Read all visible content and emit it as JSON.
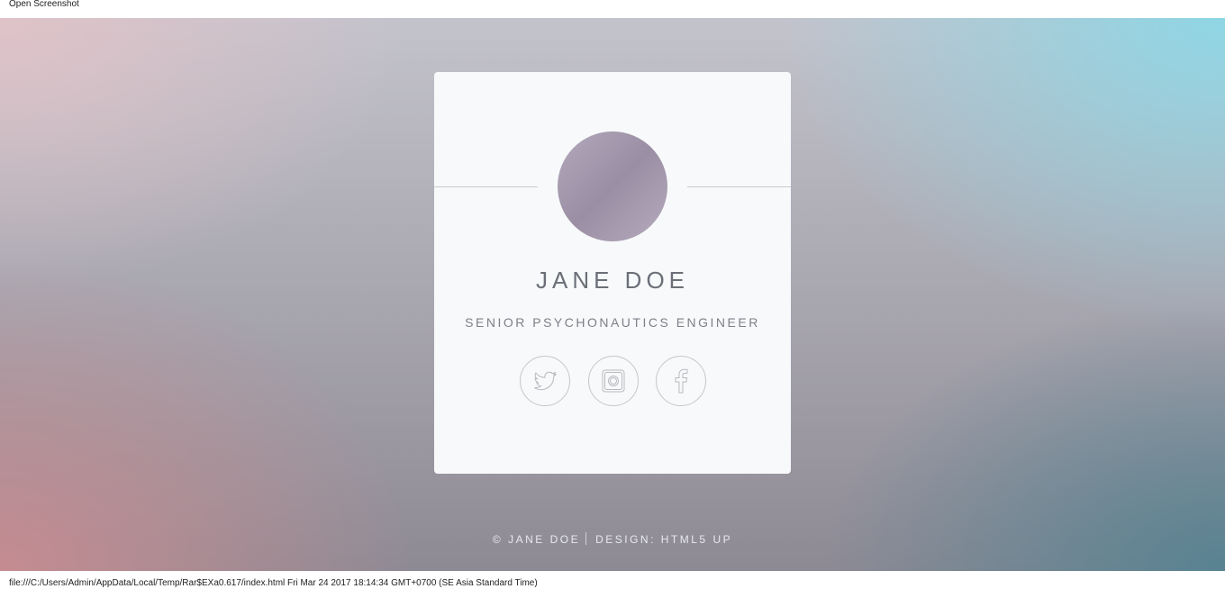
{
  "header": {
    "title": "Open Screenshot"
  },
  "profile": {
    "name": "JANE DOE",
    "role": "SENIOR PSYCHONAUTICS ENGINEER"
  },
  "socials": [
    {
      "label": "Twitter",
      "icon": "twitter-icon"
    },
    {
      "label": "Instagram",
      "icon": "instagram-icon"
    },
    {
      "label": "Facebook",
      "icon": "facebook-icon"
    }
  ],
  "footer": {
    "copyright": "© JANE DOE",
    "design_prefix": "DESIGN: ",
    "design_link": "HTML5 UP"
  },
  "status": {
    "text": "file:///C:/Users/Admin/AppData/Local/Temp/Rar$EXa0.617/index.html Fri Mar 24 2017 18:14:34 GMT+0700 (SE Asia Standard Time)"
  },
  "colors": {
    "card": "#f8f9fa",
    "text": "#6b6f77",
    "icon_stroke": "#b8babf",
    "footer_text": "#e7e9ee"
  }
}
